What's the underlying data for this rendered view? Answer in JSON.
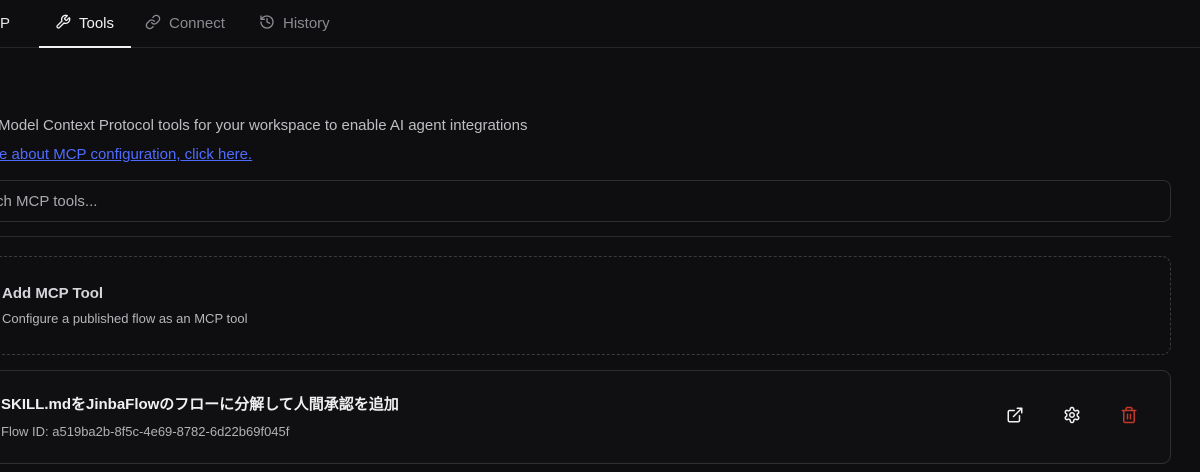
{
  "tabs": {
    "clipped_label": "P",
    "tools": "Tools",
    "connect": "Connect",
    "history": "History"
  },
  "description": {
    "text": "Model Context Protocol tools for your workspace to enable AI agent integrations",
    "link": "re about MCP configuration, click here."
  },
  "search": {
    "placeholder": "ch MCP tools..."
  },
  "add_card": {
    "title": "Add MCP Tool",
    "subtitle": "Configure a published flow as an MCP tool"
  },
  "tool": {
    "title": "SKILL.mdをJinbaFlowのフローに分解して人間承認を追加",
    "flow_id": "Flow ID: a519ba2b-8f5c-4e69-8782-6d22b69f045f"
  },
  "colors": {
    "background": "#0e0e10",
    "link": "#4f6bff",
    "delete": "#c0392b"
  },
  "icons": {
    "tools": "wrench-icon",
    "connect": "link-icon",
    "history": "history-icon",
    "open": "external-link-icon",
    "settings": "gear-icon",
    "delete": "trash-icon"
  }
}
